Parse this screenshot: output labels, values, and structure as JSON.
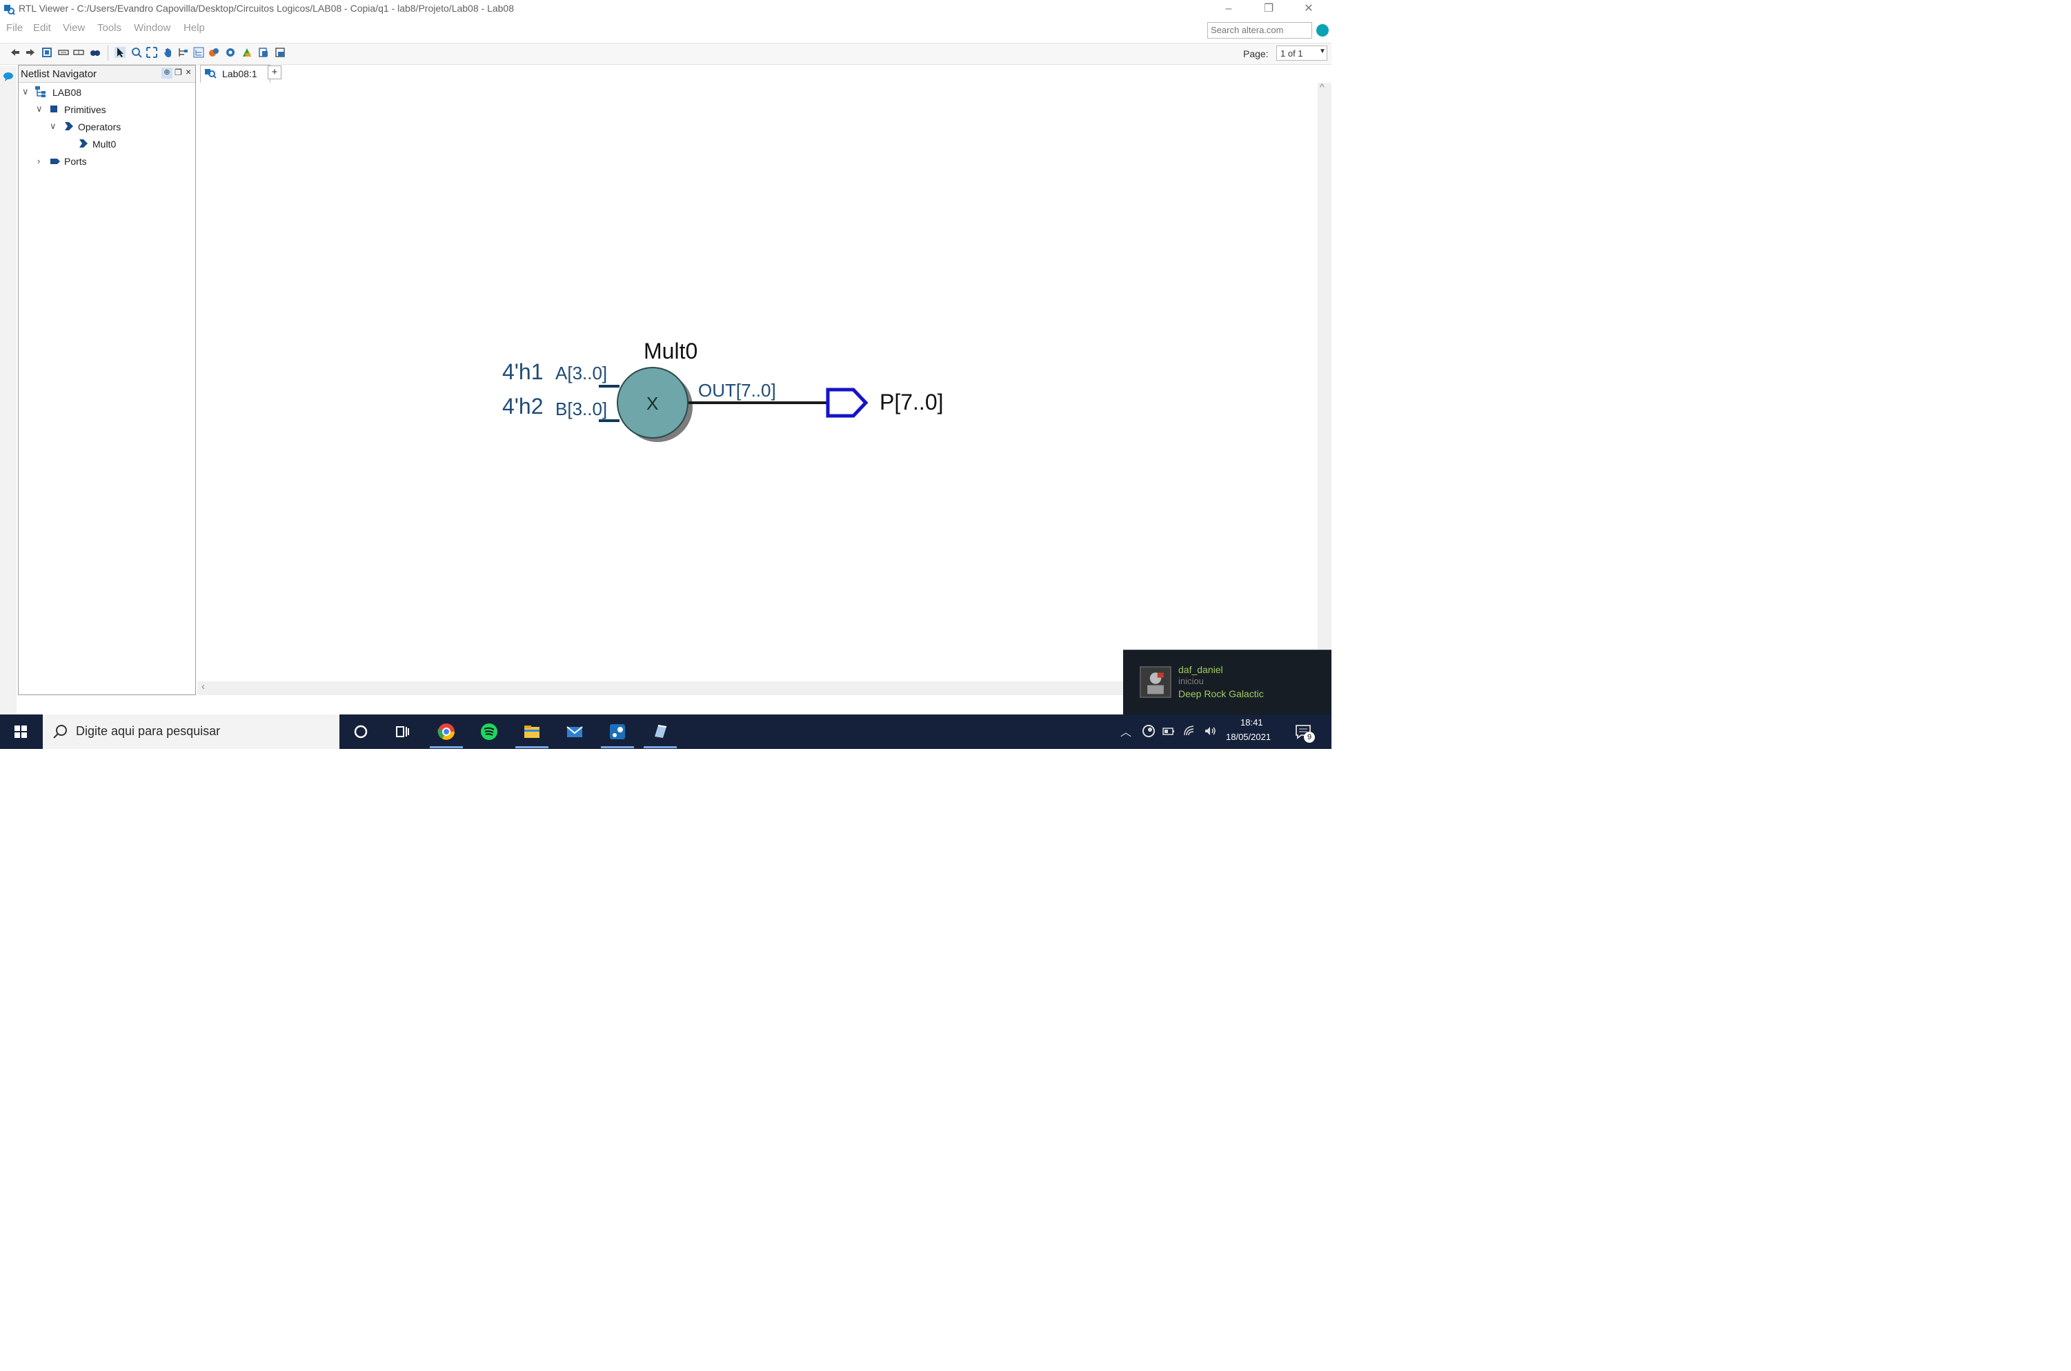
{
  "window": {
    "title": "RTL Viewer - C:/Users/Evandro Capovilla/Desktop/Circuitos Logicos/LAB08 - Copia/q1 - lab8/Projeto/Lab08 - Lab08",
    "controls": {
      "minimize": "–",
      "restore": "❐",
      "close": "✕"
    }
  },
  "menu": [
    "File",
    "Edit",
    "View",
    "Tools",
    "Window",
    "Help"
  ],
  "search": {
    "placeholder": "Search altera.com"
  },
  "toolbar": {
    "icons": [
      "back-icon",
      "forward-icon",
      "refresh-icon",
      "collapse-icon",
      "expand-icon",
      "find-icon",
      "select-icon",
      "zoom-icon",
      "fit-icon",
      "hand-icon",
      "filter-icon",
      "hierarchy-icon",
      "netlist-icon",
      "settings-icon",
      "chart-icon",
      "export-icon",
      "print-icon"
    ],
    "page_label": "Page:",
    "page_value": "1 of 1"
  },
  "navigator": {
    "title": "Netlist Navigator",
    "tree": [
      {
        "label": "LAB08",
        "level": 0,
        "expanded": true
      },
      {
        "label": "Primitives",
        "level": 1,
        "expanded": true
      },
      {
        "label": "Operators",
        "level": 2,
        "expanded": true
      },
      {
        "label": "Mult0",
        "level": 3
      },
      {
        "label": "Ports",
        "level": 1,
        "expanded": false
      }
    ]
  },
  "tab": {
    "label": "Lab08:1",
    "add": "+"
  },
  "schematic": {
    "instance_name": "Mult0",
    "operator": "X",
    "inputs": [
      {
        "constant": "4'h1",
        "port": "A[3..0]"
      },
      {
        "constant": "4'h2",
        "port": "B[3..0]"
      }
    ],
    "output_port": "OUT[7..0]",
    "output_pin": "P[7..0]",
    "colors": {
      "node_fill": "#6ea6a9",
      "wire": "#0f3a5a",
      "label": "#1e4b75",
      "output_pin": "#1414c8"
    }
  },
  "notification": {
    "user": "daf_daniel",
    "action": "iniciou",
    "game": "Deep Rock Galactic"
  },
  "taskbar": {
    "search_placeholder": "Digite aqui para pesquisar",
    "apps": [
      "cortana-icon",
      "task-view-icon",
      "chrome-icon",
      "spotify-icon",
      "file-explorer-icon",
      "mail-icon",
      "steam-icon",
      "quartus-icon"
    ],
    "time": "18:41",
    "date": "18/05/2021",
    "notifications_count": "9"
  }
}
